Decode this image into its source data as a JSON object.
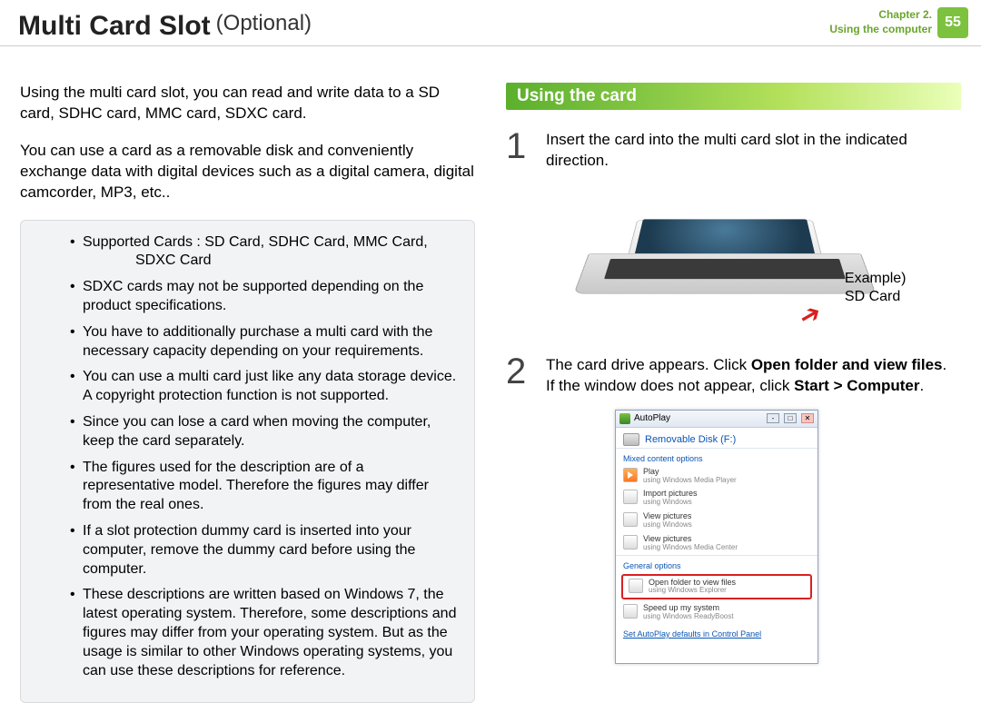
{
  "header": {
    "title_main": "Multi Card Slot",
    "title_sub": "(Optional)",
    "chapter_line1": "Chapter 2.",
    "chapter_line2": "Using the computer",
    "page_number": "55"
  },
  "left": {
    "para1": "Using the multi card slot, you can read and write data to a SD card, SDHC card, MMC card, SDXC card.",
    "para2": "You can use a card as a removable disk and conveniently exchange data with digital devices such as a digital camera, digital camcorder, MP3, etc..",
    "notes": {
      "item1a": "Supported Cards : SD Card, SDHC Card, MMC Card,",
      "item1b": "SDXC Card",
      "item2": "SDXC cards may not be supported depending on the product specifications.",
      "item3": "You have to additionally purchase a multi card with the necessary capacity depending on your requirements.",
      "item4": "You can use a multi card just like any data storage device. A copyright protection function is not supported.",
      "item5": "Since you can lose a card when moving the computer, keep the card separately.",
      "item6": "The figures used for the description are of a representative model. Therefore the figures may differ from the real ones.",
      "item7": "If a slot protection dummy card is inserted into your computer, remove the dummy card before using the computer.",
      "item8": "These descriptions are written based on Windows 7, the latest operating system. Therefore, some descriptions and figures may differ from your operating system. But as the usage is similar to other Windows operating systems, you can use these descriptions for reference."
    }
  },
  "right": {
    "section_head": "Using the card",
    "step1": {
      "num": "1",
      "text": "Insert the card into the multi card slot in the indicated direction."
    },
    "sd_label_l1": "Example)",
    "sd_label_l2": "SD Card",
    "step2": {
      "num": "2",
      "text_a": "The card drive appears. Click ",
      "text_b": "Open folder and view files",
      "text_c": ".",
      "text_d": "If the window does not appear, click ",
      "text_e": "Start > Computer",
      "text_f": "."
    },
    "autoplay": {
      "title": "AutoPlay",
      "disk": "Removable Disk (F:)",
      "group1": "Mixed content options",
      "opt_play_t": "Play",
      "opt_play_s": "using Windows Media Player",
      "opt_import_t": "Import pictures",
      "opt_import_s": "using Windows",
      "opt_view1_t": "View pictures",
      "opt_view1_s": "using Windows",
      "opt_view2_t": "View pictures",
      "opt_view2_s": "using Windows Media Center",
      "group2": "General options",
      "opt_open_t": "Open folder to view files",
      "opt_open_s": "using Windows Explorer",
      "opt_speed_t": "Speed up my system",
      "opt_speed_s": "using Windows ReadyBoost",
      "footer": "Set AutoPlay defaults in Control Panel"
    }
  }
}
